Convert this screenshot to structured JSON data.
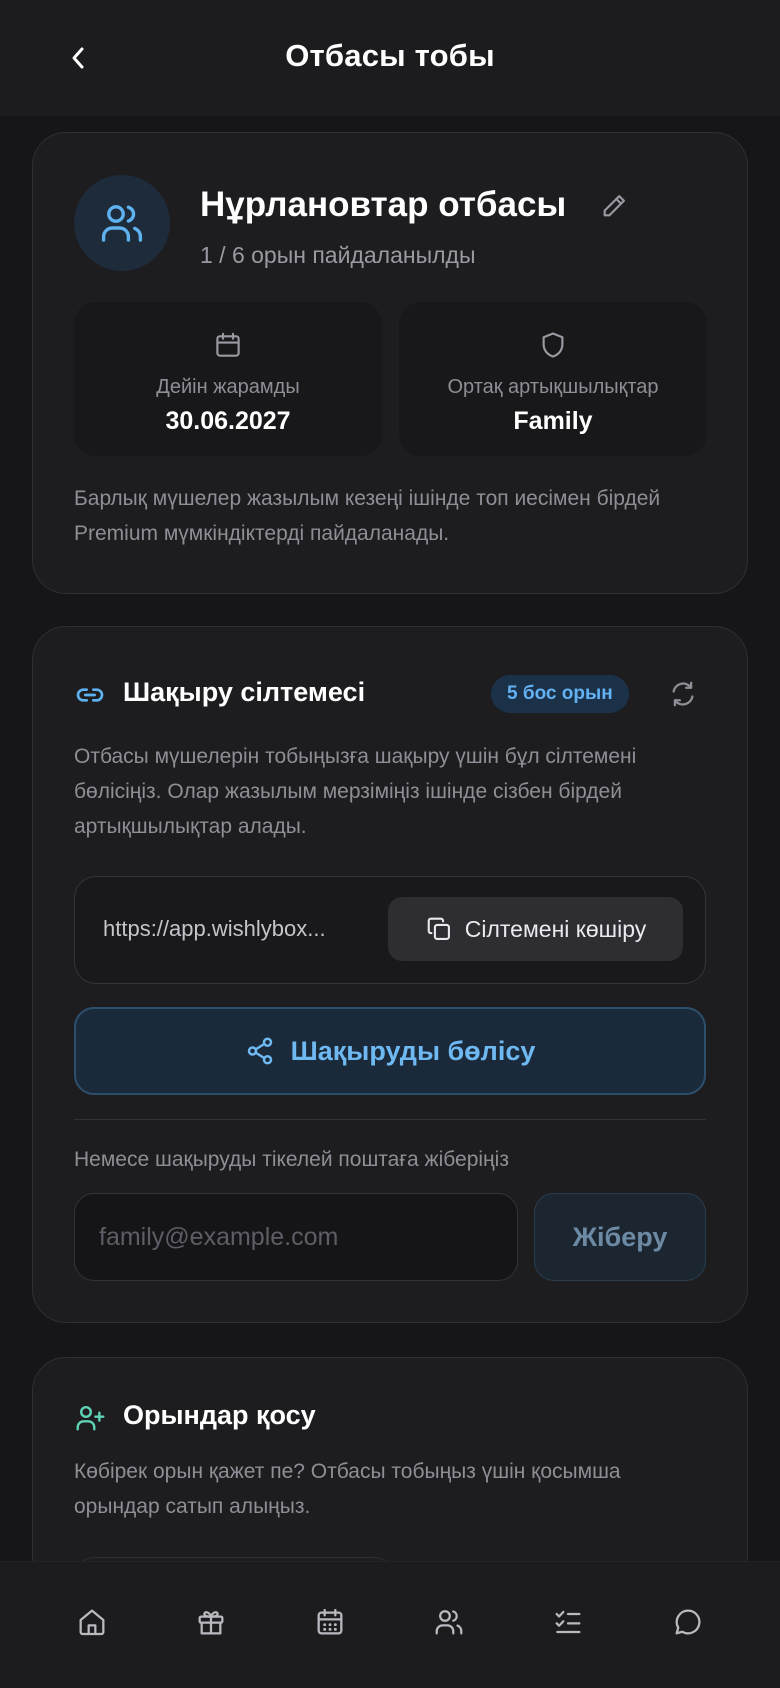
{
  "header": {
    "title": "Отбасы тобы",
    "back_icon": "chevron-left-icon"
  },
  "group": {
    "name": "Нұрлановтар отбасы",
    "seats_used": "1 / 6 орын пайдаланылды",
    "valid_until_label": "Дейін жарамды",
    "valid_until_value": "30.06.2027",
    "shared_benefits_label": "Ортақ артықшылықтар",
    "shared_benefits_value": "Family",
    "note": "Барлық мүшелер жазылым кезеңі ішінде топ иесімен бірдей Premium мүмкіндіктерді пайдаланады."
  },
  "invite": {
    "title": "Шақыру сілтемесі",
    "free_badge": "5 бос орын",
    "description": "Отбасы мүшелерін тобыңызға шақыру үшін бұл сілтемені бөлісіңіз. Олар жазылым мерзіміңіз ішінде сізбен бірдей артықшылықтар алады.",
    "link": "https://app.wishlybox...",
    "copy_label": "Сілтемені көшіру",
    "share_label": "Шақыруды бөлісу",
    "email_hint": "Немесе шақыруды тікелей поштаға жіберіңіз",
    "email_placeholder": "family@example.com",
    "email_value": "",
    "send_label": "Жіберу"
  },
  "seats": {
    "title": "Орындар қосу",
    "description": "Көбірек орын қажет пе? Отбасы тобыңыз үшін қосымша орындар сатып алыңыз."
  },
  "nav": {
    "items": [
      "home-icon",
      "gift-icon",
      "calendar-icon",
      "people-icon",
      "checklist-icon",
      "chat-icon"
    ]
  },
  "colors": {
    "background": "#161618",
    "card": "#1d1d20",
    "accent": "#62b1f3",
    "accent_green": "#5ed3b5",
    "muted_text": "#8e8e96"
  }
}
